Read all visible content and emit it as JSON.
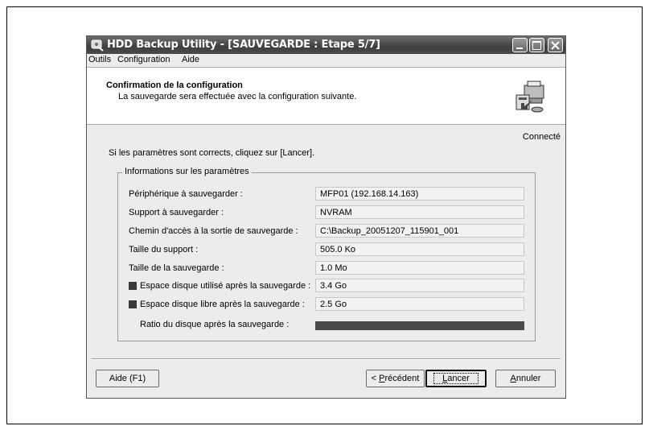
{
  "window": {
    "title": "HDD Backup Utility - [SAUVEGARDE : Etape 5/7]",
    "icon": "app-disk-icon"
  },
  "menu": {
    "items": [
      "Outils",
      "Configuration",
      "Aide"
    ]
  },
  "header": {
    "title": "Confirmation de la configuration",
    "subtitle": "La sauvegarde sera effectuée avec la configuration suivante.",
    "icon": "printer-backup-icon"
  },
  "status": "Connecté",
  "instruction": "Si les paramètres sont corrects, cliquez sur [Lancer].",
  "group": {
    "legend": "Informations sur les paramètres",
    "rows": [
      {
        "label": "Périphérique à sauvegarder :",
        "value": "MFP01  (192.168.14.163)"
      },
      {
        "label": "Support à sauvegarder :",
        "value": "NVRAM"
      },
      {
        "label": "Chemin d'accès à la sortie de sauvegarde :",
        "value": "C:\\Backup_20051207_115901_001"
      },
      {
        "label": "Taille du support :",
        "value": "505.0 Ko"
      },
      {
        "label": "Taille de la sauvegarde :",
        "value": "1.0 Mo"
      },
      {
        "label": "Espace disque utilisé après la sauvegarde :",
        "value": "3.4 Go"
      },
      {
        "label": "Espace disque libre après la sauvegarde :",
        "value": "2.5 Go"
      }
    ],
    "ratio_label": "Ratio du disque après la sauvegarde :",
    "ratio_used_fraction": 1.0,
    "swatch_color": "#3a3a3a"
  },
  "buttons": {
    "help": "Aide (F1)",
    "previous_prefix": "< ",
    "previous_mnemonic": "P",
    "previous_rest": "récédent",
    "launch_mnemonic": "L",
    "launch_rest": "ancer",
    "cancel_mnemonic": "A",
    "cancel_rest": "nnuler"
  }
}
